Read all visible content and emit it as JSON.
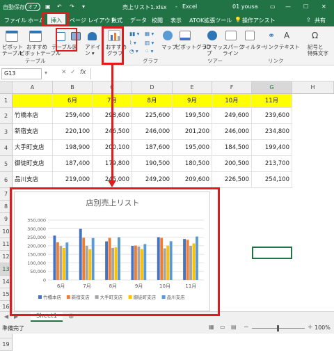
{
  "titlebar": {
    "autosave": "自動保存",
    "autosave_state": "オフ",
    "filename": "売上リスト1.xlsx",
    "app": "Excel",
    "user": "01 yousa"
  },
  "tabs": [
    "ファイル",
    "ホーム",
    "挿入",
    "ページ レイアウト",
    "数式",
    "データ",
    "校閲",
    "表示",
    "ATOK拡張ツール"
  ],
  "tell_me": "操作アシスト",
  "share": "共有",
  "ribbon": {
    "pivot_table": [
      "ピボット",
      "テーブル"
    ],
    "recommended_pivot": [
      "おすすめ",
      "ピボットテーブル"
    ],
    "table": "テーブル",
    "illustrations": "図",
    "addins": "アドイ",
    "recommended_charts": [
      "おすすめ",
      "グラフ"
    ],
    "maps": "マップ",
    "pivot_chart": "ピボットグラフ",
    "map3d": [
      "3D マッ",
      "プ"
    ],
    "sparklines": [
      "スパーク",
      "ライン"
    ],
    "filters": "フィルター",
    "link": "リンク",
    "text": "テキスト",
    "symbols": [
      "記号と",
      "特殊文字"
    ],
    "groups": [
      "テーブル",
      "グラフ",
      "ツアー",
      "リンク"
    ]
  },
  "namebox": "G13",
  "fx": "fx",
  "columns": [
    "A",
    "B",
    "C",
    "D",
    "E",
    "F",
    "G",
    "H"
  ],
  "rows": [
    "1",
    "2",
    "3",
    "4",
    "5",
    "6",
    "7",
    "8",
    "9",
    "10",
    "11",
    "12",
    "13",
    "14",
    "15",
    "16",
    "17",
    "18",
    "19"
  ],
  "table": {
    "months": [
      "6月",
      "7月",
      "8月",
      "9月",
      "10月",
      "11月"
    ],
    "stores": [
      {
        "name": "竹橋本店",
        "values": [
          "259,400",
          "298,600",
          "225,600",
          "199,500",
          "249,600",
          "239,600"
        ]
      },
      {
        "name": "新宿支店",
        "values": [
          "220,100",
          "246,500",
          "246,000",
          "201,200",
          "246,000",
          "234,800"
        ]
      },
      {
        "name": "大手町支店",
        "values": [
          "198,900",
          "200,100",
          "187,600",
          "195,000",
          "184,500",
          "199,400"
        ]
      },
      {
        "name": "御徒町支店",
        "values": [
          "187,400",
          "179,800",
          "190,500",
          "180,500",
          "200,500",
          "213,700"
        ]
      },
      {
        "name": "品川支店",
        "values": [
          "219,000",
          "245,000",
          "249,200",
          "209,600",
          "226,500",
          "254,100"
        ]
      }
    ]
  },
  "colors": {
    "excel_green": "#217346",
    "highlight_red": "#e01b1b",
    "header_yellow": "#ffff00",
    "series": [
      "#4472c4",
      "#ed7d31",
      "#a5a5a5",
      "#ffc000",
      "#5b9bd5"
    ]
  },
  "chart_data": {
    "type": "bar",
    "title": "店別売上リスト",
    "categories": [
      "6月",
      "7月",
      "8月",
      "9月",
      "10月",
      "11月"
    ],
    "series": [
      {
        "name": "竹橋本店",
        "values": [
          259400,
          298600,
          225600,
          199500,
          249600,
          239600
        ]
      },
      {
        "name": "新宿支店",
        "values": [
          220100,
          246500,
          246000,
          201200,
          246000,
          234800
        ]
      },
      {
        "name": "大手町支店",
        "values": [
          198900,
          200100,
          187600,
          195000,
          184500,
          199400
        ]
      },
      {
        "name": "御徒町支店",
        "values": [
          187400,
          179800,
          190500,
          180500,
          200500,
          213700
        ]
      },
      {
        "name": "品川支店",
        "values": [
          219000,
          245000,
          249200,
          209600,
          226500,
          254100
        ]
      }
    ],
    "yticks": [
      "0",
      "50,000",
      "100,000",
      "150,000",
      "200,000",
      "250,000",
      "300,000",
      "350,000"
    ],
    "ylim": [
      0,
      350000
    ],
    "legend": "bottom",
    "grid": true
  },
  "sheet_tab": "Sheet1",
  "status": {
    "ready": "準備完了",
    "zoom": "100%"
  }
}
